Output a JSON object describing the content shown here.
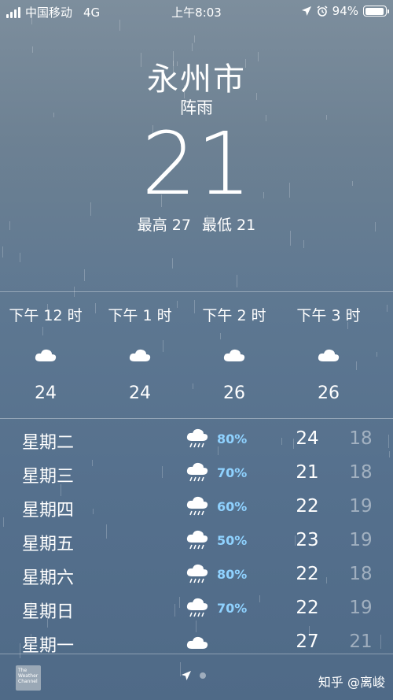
{
  "status_bar": {
    "carrier": "中国移动",
    "network": "4G",
    "time": "上午8:03",
    "battery": "94%",
    "battery_level": 0.94
  },
  "header": {
    "city": "永州市",
    "condition": "阵雨",
    "temperature": "21",
    "high": "最高 27",
    "low": "最低 21"
  },
  "hourly": [
    {
      "time": "下午 12 时",
      "icon": "cloud-icon",
      "temp": "24"
    },
    {
      "time": "下午 1 时",
      "icon": "cloud-icon",
      "temp": "24"
    },
    {
      "time": "下午 2 时",
      "icon": "cloud-icon",
      "temp": "26"
    },
    {
      "time": "下午 3 时",
      "icon": "cloud-icon",
      "temp": "26"
    }
  ],
  "daily": [
    {
      "day": "星期二",
      "icon": "rain-cloud-icon",
      "pop": "80%",
      "high": "24",
      "low": "18"
    },
    {
      "day": "星期三",
      "icon": "rain-cloud-icon",
      "pop": "70%",
      "high": "21",
      "low": "18"
    },
    {
      "day": "星期四",
      "icon": "rain-cloud-icon",
      "pop": "60%",
      "high": "22",
      "low": "19"
    },
    {
      "day": "星期五",
      "icon": "rain-cloud-icon",
      "pop": "50%",
      "high": "23",
      "low": "19"
    },
    {
      "day": "星期六",
      "icon": "rain-cloud-icon",
      "pop": "80%",
      "high": "22",
      "low": "18"
    },
    {
      "day": "星期日",
      "icon": "rain-cloud-icon",
      "pop": "70%",
      "high": "22",
      "low": "19"
    },
    {
      "day": "星期一",
      "icon": "cloud-icon",
      "pop": "",
      "high": "27",
      "low": "21"
    }
  ],
  "bottom": {
    "logo_text": "The Weather Channel",
    "watermark": "知乎 @离峻"
  },
  "colors": {
    "precip": "#8fd2ff"
  }
}
